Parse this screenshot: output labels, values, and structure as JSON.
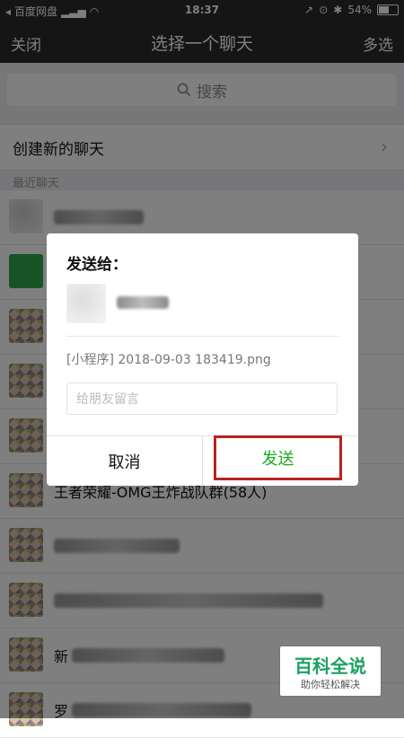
{
  "status_bar": {
    "carrier": "百度网盘",
    "time": "18:37",
    "battery_percent": "54%",
    "battery_level": 0.54
  },
  "nav": {
    "close_label": "关闭",
    "title": "选择一个聊天",
    "multi_select_label": "多选"
  },
  "search": {
    "placeholder": "搜索"
  },
  "new_chat_label": "创建新的聊天",
  "recent_label": "最近聊天",
  "chat_list": [
    {
      "name": ""
    },
    {
      "name": ""
    },
    {
      "name": ""
    },
    {
      "name": ""
    },
    {
      "name": ""
    },
    {
      "name": "王者荣耀-OMG王炸战队群(58人)"
    },
    {
      "name": ""
    },
    {
      "name": ""
    },
    {
      "name": "新"
    },
    {
      "name": "罗"
    }
  ],
  "dialog": {
    "title": "发送给：",
    "attachment_text": "[小程序] 2018-09-03 183419.png",
    "message_placeholder": "给朋友留言",
    "cancel_label": "取消",
    "send_label": "发送"
  },
  "watermark": {
    "title": "百科全说",
    "subtitle": "助你轻松解决"
  },
  "colors": {
    "send_green": "#1aad19",
    "highlight_red": "#b8231e",
    "nav_dark": "#2a2a2a"
  }
}
